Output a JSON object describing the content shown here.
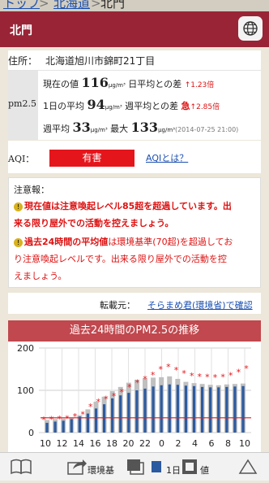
{
  "breadcrumb": {
    "items": [
      "トップ",
      "北海道",
      "北門"
    ],
    "separator": ">"
  },
  "header": {
    "title": "北門"
  },
  "info": {
    "address_label": "住所：",
    "address": "北海道旭川市錦町21丁目",
    "pm_label": "pm2.5",
    "current_label": "現在の値",
    "current_value": "116",
    "unit": "μg/m³",
    "ratio_prev_day_label": "日平均との差",
    "ratio_prev_day": "↑1.23倍",
    "daily_avg_label": "1日の平均",
    "daily_avg": "94",
    "weekly_diff_label": "週平均との差",
    "weekly_diff_flag": "急",
    "weekly_diff": "↑2.85倍",
    "weekly_avg_label": "週平均",
    "weekly_avg": "33",
    "max_label": "最大",
    "max_value": "133",
    "max_time": "(2014-07-25 21:00)",
    "aqi_label": "AQI：",
    "aqi_status": "有害",
    "aqi_link": "AQIとは？"
  },
  "caution": {
    "heading": "注意報：",
    "msg1": {
      "lead": "現在値",
      "line1": "は注意喚起レベル85超を超過しています。出",
      "line2": "来る限り屋外での活動を控えましょう。"
    },
    "msg2": {
      "lead": "過去24時間の平均値",
      "line1": "は環境基準(70超)を超過してお",
      "line2": "り注意喚起レベルです。出来る限り屋外での活動を控",
      "line3": "えましょう。"
    }
  },
  "source": {
    "label": "転載元：",
    "link": "そらまめ君(環境省)で確認"
  },
  "chart_data": {
    "type": "bar",
    "title": "過去24時間のPM2.5の推移",
    "ylim": [
      0,
      200
    ],
    "yticks": [
      "200",
      "100",
      "0"
    ],
    "x_labels": [
      "10",
      "12",
      "14",
      "16",
      "18",
      "20",
      "22",
      "0",
      "2",
      "4",
      "6",
      "8",
      "10"
    ],
    "series": [
      {
        "type": "bar",
        "color": "#2b5aa0",
        "values": [
          23,
          26,
          28,
          32,
          38,
          45,
          57,
          67,
          81,
          88,
          94,
          100,
          104,
          109,
          112,
          114,
          113,
          111,
          110,
          108,
          107,
          107,
          108,
          109,
          110
        ]
      },
      {
        "type": "bar",
        "color": "#c0c0c0",
        "values": [
          30,
          32,
          33,
          35,
          41,
          55,
          73,
          85,
          98,
          108,
          118,
          125,
          128,
          130,
          131,
          133,
          127,
          120,
          117,
          115,
          113,
          112,
          114,
          115,
          116
        ]
      },
      {
        "type": "marker",
        "color": "#e5161b",
        "values": [
          31,
          32,
          33,
          34,
          38,
          43,
          62,
          73,
          80,
          87,
          96,
          108,
          118,
          127,
          137,
          150,
          156,
          148,
          140,
          135,
          133,
          132,
          131,
          132,
          136,
          143,
          152
        ]
      },
      {
        "type": "line",
        "name": "環境基準",
        "color": "#e5161b",
        "values": [
          35
        ]
      }
    ],
    "grid": true
  },
  "toolbar": {
    "bookmark_icon": "book-icon",
    "share_icon": "share-icon",
    "env_label": "環境基",
    "tabs_icon": "tabs-icon",
    "day_label": "1日",
    "tab_icon": "tab-icon",
    "mode_label": "値",
    "up_icon": "triangle-up-icon"
  }
}
